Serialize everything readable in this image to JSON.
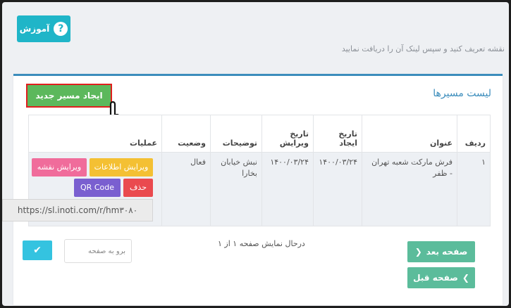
{
  "help": {
    "label": "آموزش"
  },
  "top_note": "نقشه تعریف کنید و سپس لینک آن را دریافت نمایید",
  "panel": {
    "title": "لیست مسیرها",
    "create_label": "ایجاد مسیر جدید"
  },
  "table": {
    "headers": {
      "row": "ردیف",
      "title": "عنوان",
      "created": "تاریخ ایجاد",
      "edited": "تاریخ ویرایش",
      "desc": "توضیحات",
      "status": "وضعیت",
      "ops": "عملیات"
    },
    "rows": [
      {
        "row": "۱",
        "title": "فرش مارکت شعبه تهران - ظفر",
        "created": "۱۴۰۰/۰۳/۲۴",
        "edited": "۱۴۰۰/۰۳/۲۴",
        "desc": "نبش خیابان بخارا",
        "status": "فعال",
        "edit_info": "ویرایش اطلاعات",
        "edit_map": "ویرایش نقشه",
        "delete": "حذف",
        "qr": "QR Code",
        "link": "https://sl.inoti.com/r/hm۳۰۸۰"
      }
    ]
  },
  "pagination": {
    "info": "درحال نمایش صفحه ۱ از ۱",
    "goto_placeholder": "برو به صفحه",
    "next": "صفحه بعد",
    "prev": "صفحه قبل"
  },
  "colors": {
    "accent": "#3c8dbc",
    "help": "#1fb5c8",
    "create": "#5cb85c",
    "nav": "#5bbc9b"
  }
}
